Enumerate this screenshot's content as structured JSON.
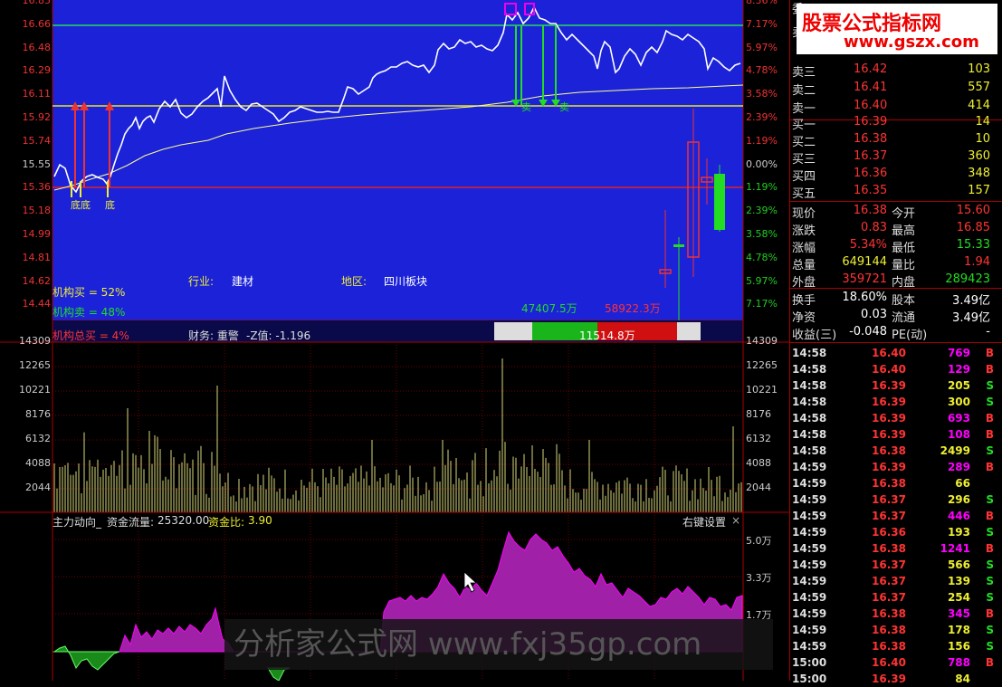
{
  "brand": {
    "line1": "股票公式指标网",
    "line2": "www.gszx.com"
  },
  "watermark": {
    "text": "分析家公式网 www.fxj35gp.com"
  },
  "price_axis": {
    "left": [
      "16.85",
      "16.66",
      "16.48",
      "16.29",
      "16.11",
      "15.92",
      "15.74",
      "15.55",
      "15.36",
      "15.18",
      "14.99",
      "14.81",
      "14.62",
      "14.44"
    ],
    "right": [
      "8.36%",
      "7.17%",
      "5.97%",
      "4.78%",
      "3.58%",
      "2.39%",
      "1.19%",
      "0.00%",
      "1.19%",
      "2.39%",
      "3.58%",
      "4.78%",
      "5.97%",
      "7.17%"
    ]
  },
  "volume_axis": [
    "14309",
    "12265",
    "10221",
    "8176",
    "6132",
    "4088",
    "2044"
  ],
  "indicator_axis": [
    "5.0万",
    "3.3万",
    "1.7万"
  ],
  "info": {
    "industry_label": "行业:",
    "industry": "建材",
    "region_label": "地区:",
    "region": "四川板块",
    "inst_buy": "机构买 = 52%",
    "inst_sell": "机构卖 = 48%",
    "inst_total": "机构总买 = 4%",
    "finance": "财务: 重警",
    "zscore": "-Z值: -1.196",
    "flow_buy": "47407.5万",
    "flow_sell": "58922.3万",
    "flow_net": "11514.8万"
  },
  "markers": {
    "bottom": "底",
    "sell": "卖",
    "double_bottom": "底底"
  },
  "indicator": {
    "title": "主力动向_",
    "flow_label": "资金流量:",
    "flow_value": "25320.00",
    "ratio_label": "资金比:",
    "ratio_value": "3.90",
    "settings": "右键设置",
    "close": "×"
  },
  "quote": {
    "cutoff": [
      "委",
      "卖四"
    ],
    "asks": [
      {
        "label": "卖三",
        "price": "16.42",
        "vol": "103"
      },
      {
        "label": "卖二",
        "price": "16.41",
        "vol": "557"
      },
      {
        "label": "卖一",
        "price": "16.40",
        "vol": "414"
      }
    ],
    "bids": [
      {
        "label": "买一",
        "price": "16.39",
        "vol": "14"
      },
      {
        "label": "买二",
        "price": "16.38",
        "vol": "10"
      },
      {
        "label": "买三",
        "price": "16.37",
        "vol": "360"
      },
      {
        "label": "买四",
        "price": "16.36",
        "vol": "348"
      },
      {
        "label": "买五",
        "price": "16.35",
        "vol": "157"
      }
    ],
    "stats": [
      {
        "l1": "现价",
        "v1": "16.38",
        "l2": "今开",
        "v2": "15.60",
        "c1": "#f33",
        "c2": "#f33"
      },
      {
        "l1": "涨跌",
        "v1": "0.83",
        "l2": "最高",
        "v2": "16.85",
        "c1": "#f33",
        "c2": "#f33"
      },
      {
        "l1": "涨幅",
        "v1": "5.34%",
        "l2": "最低",
        "v2": "15.33",
        "c1": "#f33",
        "c2": "#2d2"
      },
      {
        "l1": "总量",
        "v1": "649144",
        "l2": "量比",
        "v2": "1.94",
        "c1": "#ee3",
        "c2": "#f33"
      },
      {
        "l1": "外盘",
        "v1": "359721",
        "l2": "内盘",
        "v2": "289423",
        "c1": "#f33",
        "c2": "#2d2"
      }
    ],
    "fund": [
      {
        "l1": "换手",
        "v1": "18.60%",
        "l2": "股本",
        "v2": "3.49亿"
      },
      {
        "l1": "净资",
        "v1": "0.03",
        "l2": "流通",
        "v2": "3.49亿"
      },
      {
        "l1": "收益(三)",
        "v1": "-0.048",
        "l2": "PE(动)",
        "v2": "-"
      }
    ]
  },
  "ticks": [
    {
      "t": "14:58",
      "p": "16.40",
      "v": "769",
      "s": "B"
    },
    {
      "t": "14:58",
      "p": "16.40",
      "v": "129",
      "s": "B"
    },
    {
      "t": "14:58",
      "p": "16.39",
      "v": "205",
      "s": "S"
    },
    {
      "t": "14:58",
      "p": "16.39",
      "v": "300",
      "s": "S"
    },
    {
      "t": "14:58",
      "p": "16.39",
      "v": "693",
      "s": "B"
    },
    {
      "t": "14:58",
      "p": "16.39",
      "v": "108",
      "s": "B"
    },
    {
      "t": "14:58",
      "p": "16.38",
      "v": "2499",
      "s": "S"
    },
    {
      "t": "14:59",
      "p": "16.39",
      "v": "289",
      "s": "B"
    },
    {
      "t": "14:59",
      "p": "16.38",
      "v": "66",
      "s": ""
    },
    {
      "t": "14:59",
      "p": "16.37",
      "v": "296",
      "s": "S"
    },
    {
      "t": "14:59",
      "p": "16.37",
      "v": "446",
      "s": "B"
    },
    {
      "t": "14:59",
      "p": "16.36",
      "v": "193",
      "s": "S"
    },
    {
      "t": "14:59",
      "p": "16.38",
      "v": "1241",
      "s": "B"
    },
    {
      "t": "14:59",
      "p": "16.37",
      "v": "566",
      "s": "S"
    },
    {
      "t": "14:59",
      "p": "16.37",
      "v": "139",
      "s": "S"
    },
    {
      "t": "14:59",
      "p": "16.37",
      "v": "254",
      "s": "S"
    },
    {
      "t": "14:59",
      "p": "16.38",
      "v": "345",
      "s": "B"
    },
    {
      "t": "14:59",
      "p": "16.38",
      "v": "178",
      "s": "S"
    },
    {
      "t": "14:59",
      "p": "16.38",
      "v": "156",
      "s": "S"
    },
    {
      "t": "15:00",
      "p": "16.40",
      "v": "788",
      "s": "B"
    },
    {
      "t": "15:00",
      "p": "16.39",
      "v": "84",
      "s": ""
    }
  ],
  "colors": {
    "up": "#f33",
    "down": "#2d2",
    "panel_bg": "#1b22d8",
    "yellow": "#ee3",
    "purple": "#a0a"
  }
}
